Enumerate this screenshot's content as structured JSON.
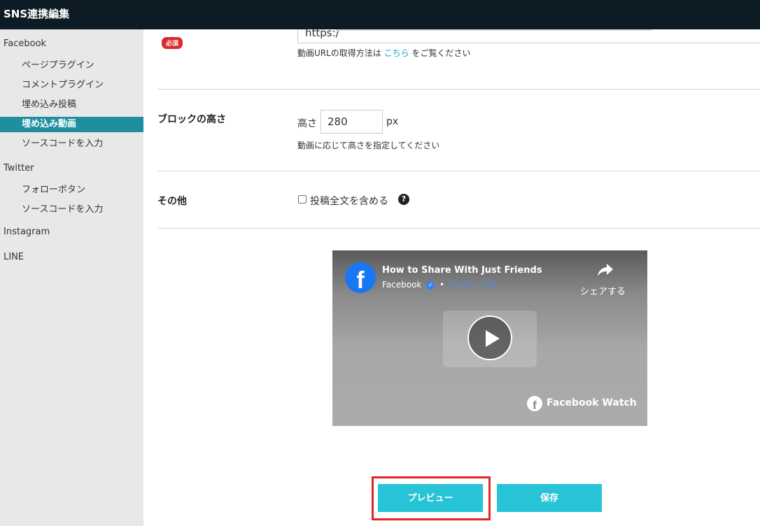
{
  "header": {
    "title": "SNS連携編集"
  },
  "sidebar": {
    "groups": [
      {
        "label": "Facebook",
        "items": [
          "ページプラグイン",
          "コメントプラグイン",
          "埋め込み投稿",
          "埋め込み動画",
          "ソースコードを入力"
        ]
      },
      {
        "label": "Twitter",
        "items": [
          "フォローボタン",
          "ソースコードを入力"
        ]
      },
      {
        "label": "Instagram",
        "items": []
      },
      {
        "label": "LINE",
        "items": []
      }
    ],
    "active_item": "埋め込み動画"
  },
  "form": {
    "video_url": {
      "required_badge": "必須",
      "value": "https:/",
      "help_prefix": "動画URLの取得方法は",
      "help_link": "こちら",
      "help_suffix": "をご覧ください"
    },
    "block_height": {
      "label": "ブロックの高さ",
      "prefix": "高さ",
      "value": "280",
      "unit": "px",
      "help": "動画に応じて高さを指定してください"
    },
    "other": {
      "label": "その他",
      "checkbox_label": "投稿全文を含める",
      "checked": false,
      "help_icon": "question-circle-icon"
    }
  },
  "preview_video": {
    "title": "How to Share With Just Friends",
    "page_name": "Facebook",
    "separator": "•",
    "follow": "フォローする",
    "share": "シェアする",
    "watch": "Facebook Watch"
  },
  "buttons": {
    "preview": "プレビュー",
    "save": "保存"
  },
  "colors": {
    "accent": "#27c4d8",
    "active_nav": "#1f8e9e",
    "header_bg": "#0d1c24",
    "required": "#d92b2b",
    "highlight": "#e02626"
  }
}
